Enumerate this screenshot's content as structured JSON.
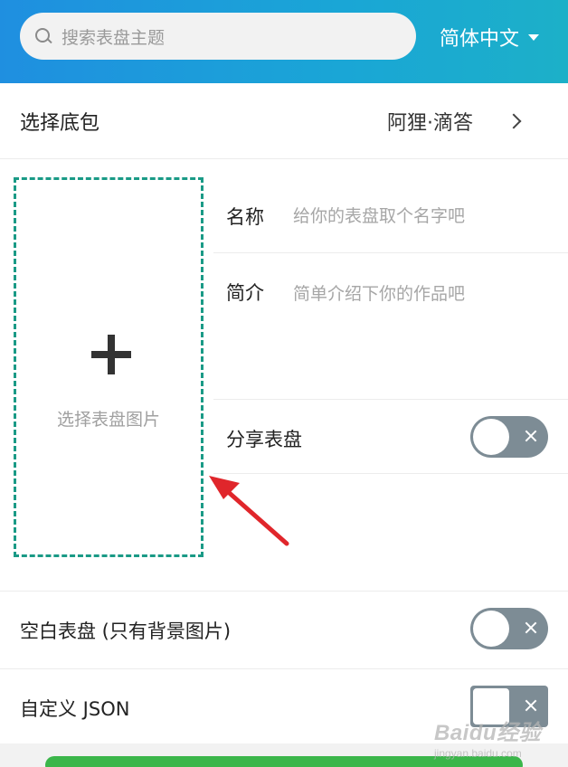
{
  "header": {
    "search_placeholder": "搜索表盘主题",
    "language": "简体中文"
  },
  "base_package": {
    "label": "选择底包",
    "value": "阿狸·滴答"
  },
  "upload": {
    "label": "选择表盘图片"
  },
  "form": {
    "name_label": "名称",
    "name_placeholder": "给你的表盘取个名字吧",
    "desc_label": "简介",
    "desc_placeholder": "简单介绍下你的作品吧"
  },
  "share": {
    "label": "分享表盘",
    "on": false
  },
  "options": {
    "blank_label": "空白表盘 (只有背景图片)",
    "blank_on": false,
    "json_label": "自定义 JSON",
    "json_on": false
  },
  "watermark": {
    "main": "Baidu经验",
    "sub": "jingyan.baidu.com"
  },
  "colors": {
    "header_gradient_start": "#1f8fe0",
    "header_gradient_end": "#1cb0c8",
    "dashed_border": "#1a9a86",
    "toggle_off": "#7d8c95",
    "annotation_arrow": "#e0262b",
    "primary_button": "#3bb64a"
  }
}
